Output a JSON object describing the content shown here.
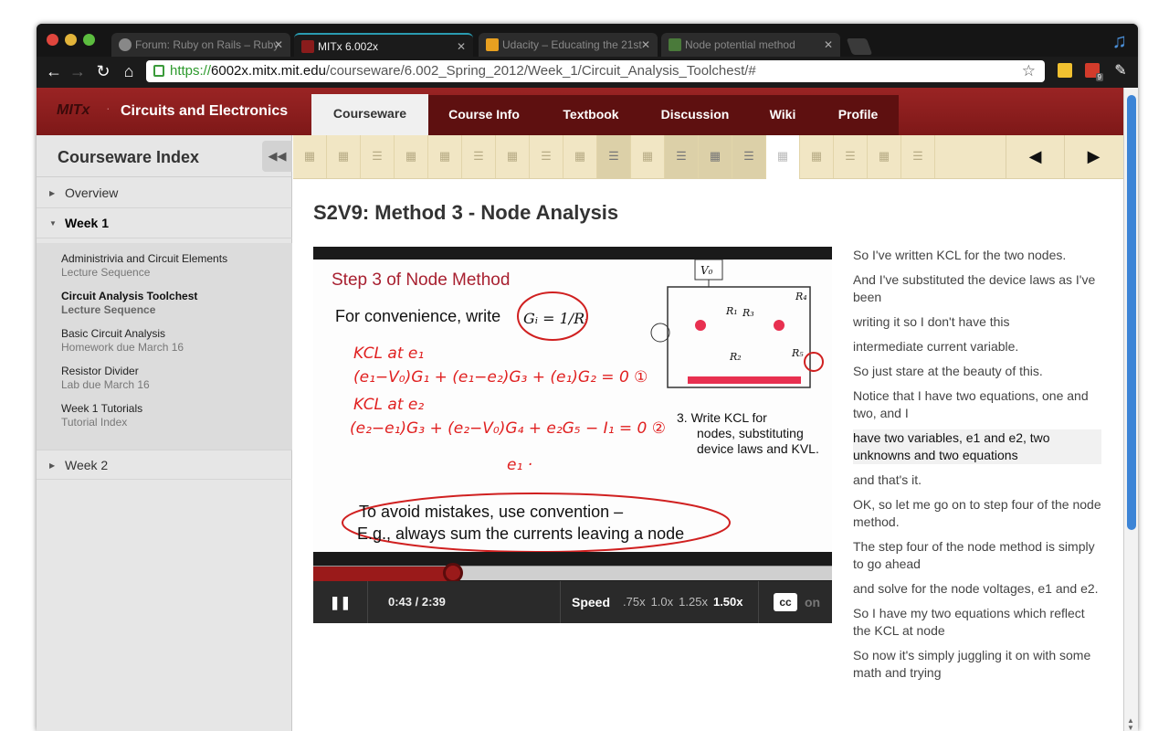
{
  "browser": {
    "tabs": [
      {
        "title": "Forum: Ruby on Rails – Ruby"
      },
      {
        "title": "MITx 6.002x"
      },
      {
        "title": "Udacity – Educating the 21st"
      },
      {
        "title": "Node potential method"
      }
    ],
    "tab_close_glyph": "✕",
    "url_scheme": "https://",
    "url_host": "6002x.mitx.mit.edu",
    "url_path": "/courseware/6.002_Spring_2012/Week_1/Circuit_Analysis_Toolchest/#",
    "gmail_badge": "9"
  },
  "header": {
    "logo": "MITx",
    "separator": "·",
    "course": "Circuits and Electronics",
    "tabs": [
      "Courseware",
      "Course Info",
      "Textbook",
      "Discussion",
      "Wiki",
      "Profile"
    ]
  },
  "sidebar": {
    "title": "Courseware Index",
    "chapters": [
      {
        "label": "Overview"
      },
      {
        "label": "Week 1"
      },
      {
        "label": "Week 2"
      }
    ],
    "sections": [
      {
        "title": "Administrivia and Circuit Elements",
        "subtitle": "Lecture Sequence"
      },
      {
        "title": "Circuit Analysis Toolchest",
        "subtitle": "Lecture Sequence"
      },
      {
        "title": "Basic Circuit Analysis",
        "subtitle": "Homework due March 16"
      },
      {
        "title": "Resistor Divider",
        "subtitle": "Lab due March 16"
      },
      {
        "title": "Week 1 Tutorials",
        "subtitle": "Tutorial Index"
      }
    ]
  },
  "main": {
    "video_title": "S2V9: Method 3 - Node Analysis"
  },
  "slide": {
    "heading": "Step 3 of Node Method",
    "line1": "For convenience, write",
    "formula": "Gᵢ = 1/Rᵢ",
    "hand": [
      "KCL at e₁",
      "(e₁−V₀)G₁ + (e₁−e₂)G₃ + (e₁)G₂ = 0  ①",
      "KCL at e₂",
      "(e₂−e₁)G₃ + (e₂−V₀)G₄ + e₂G₅ − I₁ = 0  ②",
      "e₁ ·"
    ],
    "circuit": {
      "v0": "V₀",
      "r1": "R₁",
      "r3": "R₃",
      "r4": "R₄",
      "r2": "R₂",
      "r5": "R₅"
    },
    "step3": [
      "3.  Write KCL for",
      "nodes, substituting",
      "device laws and KVL."
    ],
    "convention": [
      "To avoid mistakes, use convention –",
      "E.g., always sum the currents leaving a node"
    ]
  },
  "video": {
    "pause_glyph": "❚❚",
    "time": "0:43 / 2:39",
    "progress": 0.27,
    "speed_label": "Speed",
    "speeds": [
      ".75x",
      "1.0x",
      "1.25x",
      "1.50x"
    ],
    "selected_speed": "1.50x",
    "cc_label": "cc",
    "cc_state": "on"
  },
  "transcript": [
    "So I've written KCL for the two nodes.",
    "And I've substituted the device laws as I've been",
    "writing it so I don't have this",
    "intermediate current variable.",
    "So just stare at the beauty of this.",
    "Notice that I have two equations, one and two, and I",
    "have two variables, e1 and e2, two unknowns and two equations",
    "and that's it.",
    "OK, so let me go on to step four of the node method.",
    "The step four of the node method is simply to go ahead",
    "and solve for the node voltages, e1 and e2.",
    "So I have my two equations which reflect the KCL at node",
    "So now it's simply juggling it on with some math and trying"
  ]
}
